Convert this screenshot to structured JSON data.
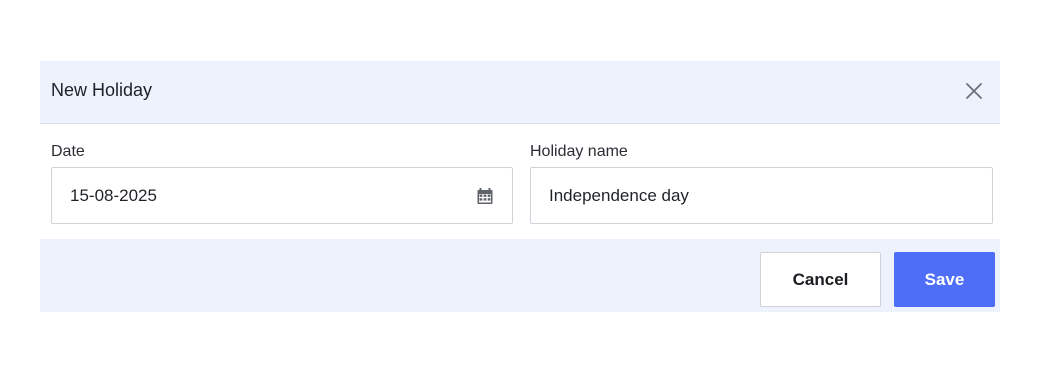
{
  "dialog": {
    "title": "New Holiday",
    "close_icon": "close-icon"
  },
  "form": {
    "date": {
      "label": "Date",
      "value": "15-08-2025",
      "icon": "calendar-icon"
    },
    "holiday_name": {
      "label": "Holiday name",
      "value": "Independence day"
    }
  },
  "footer": {
    "cancel_label": "Cancel",
    "save_label": "Save"
  },
  "colors": {
    "header_bg": "#edf2fd",
    "accent": "#4f6ef7"
  }
}
